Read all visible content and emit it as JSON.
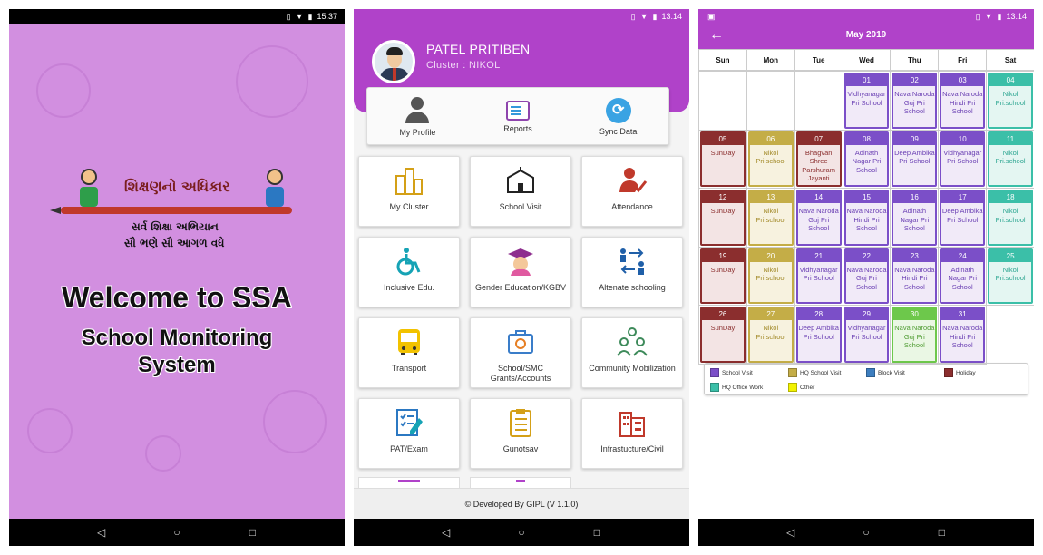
{
  "screen1": {
    "status_time": "15:37",
    "logo_title": "શિક્ષણનો અધિકાર",
    "logo_line1": "સર્વ શિક્ષા અભિયાન",
    "logo_line2": "સૌ ભણે સૌ આગળ વધે",
    "welcome": "Welcome to SSA",
    "subtitle_line1": "School Monitoring",
    "subtitle_line2": "System",
    "background_color": "#d28fe0"
  },
  "screen2": {
    "status_time": "13:14",
    "user_name": "PATEL PRITIBEN",
    "cluster": "Cluster : NIKOL",
    "header_color": "#b042c9",
    "quick_actions": [
      {
        "label": "My Profile",
        "icon": "person-icon"
      },
      {
        "label": "Reports",
        "icon": "reports-icon"
      },
      {
        "label": "Sync Data",
        "icon": "sync-icon"
      }
    ],
    "tiles": [
      {
        "label": "My Cluster",
        "icon": "buildings-icon"
      },
      {
        "label": "School Visit",
        "icon": "school-icon"
      },
      {
        "label": "Attendance",
        "icon": "attendance-icon"
      },
      {
        "label": "Inclusive Edu.",
        "icon": "wheelchair-icon"
      },
      {
        "label": "Gender Education/KGBV",
        "icon": "graduate-icon"
      },
      {
        "label": "Altenate schooling",
        "icon": "exchange-icon"
      },
      {
        "label": "Transport",
        "icon": "bus-icon"
      },
      {
        "label": "School/SMC Grants/Accounts",
        "icon": "wallet-icon"
      },
      {
        "label": "Community Mobilization",
        "icon": "community-icon"
      },
      {
        "label": "PAT/Exam",
        "icon": "exam-icon"
      },
      {
        "label": "Gunotsav",
        "icon": "checklist-icon"
      },
      {
        "label": "Infrastucture/Civil",
        "icon": "building-icon"
      }
    ],
    "footer": "© Developed By GIPL (V 1.1.0)"
  },
  "screen3": {
    "status_time": "13:14",
    "month": "May 2019",
    "days": [
      "Sun",
      "Mon",
      "Tue",
      "Wed",
      "Thu",
      "Fri",
      "Sat"
    ],
    "colors": {
      "school": "#7b4fc8",
      "hq": "#c4ad47",
      "holiday": "#8b2e2e",
      "office": "#3bbfa8",
      "green": "#6dc84b",
      "block": "#3d7ebf",
      "other": "#f2f200"
    },
    "events": [
      {
        "date": "01",
        "text": "Vidhyanagar Pri School",
        "type": "school"
      },
      {
        "date": "02",
        "text": "Nava Naroda Guj Pri School",
        "type": "school"
      },
      {
        "date": "03",
        "text": "Nava Naroda Hindi Pri School",
        "type": "school"
      },
      {
        "date": "04",
        "text": "Nikol Pri.school",
        "type": "office"
      },
      {
        "date": "05",
        "text": "SunDay",
        "type": "holiday"
      },
      {
        "date": "06",
        "text": "Nikol Pri.school",
        "type": "hq"
      },
      {
        "date": "07",
        "text": "Bhagvan Shree Parshuram Jayanti",
        "type": "holiday"
      },
      {
        "date": "08",
        "text": "Adinath Nagar Pri School",
        "type": "school"
      },
      {
        "date": "09",
        "text": "Deep Ambika Pri School",
        "type": "school"
      },
      {
        "date": "10",
        "text": "Vidhyanagar Pri School",
        "type": "school"
      },
      {
        "date": "11",
        "text": "Nikol Pri.school",
        "type": "office"
      },
      {
        "date": "12",
        "text": "SunDay",
        "type": "holiday"
      },
      {
        "date": "13",
        "text": "Nikol Pri.school",
        "type": "hq"
      },
      {
        "date": "14",
        "text": "Nava Naroda Guj Pri School",
        "type": "school"
      },
      {
        "date": "15",
        "text": "Nava Naroda Hindi Pri School",
        "type": "school"
      },
      {
        "date": "16",
        "text": "Adinath Nagar Pri School",
        "type": "school"
      },
      {
        "date": "17",
        "text": "Deep Ambika Pri School",
        "type": "school"
      },
      {
        "date": "18",
        "text": "Nikol Pri.school",
        "type": "office"
      },
      {
        "date": "19",
        "text": "SunDay",
        "type": "holiday"
      },
      {
        "date": "20",
        "text": "Nikol Pri.school",
        "type": "hq"
      },
      {
        "date": "21",
        "text": "Vidhyanagar Pri School",
        "type": "school"
      },
      {
        "date": "22",
        "text": "Nava Naroda Guj Pri School",
        "type": "school"
      },
      {
        "date": "23",
        "text": "Nava Naroda Hindi Pri School",
        "type": "school"
      },
      {
        "date": "24",
        "text": "Adinath Nagar Pri School",
        "type": "school"
      },
      {
        "date": "25",
        "text": "Nikol Pri.school",
        "type": "office"
      },
      {
        "date": "26",
        "text": "SunDay",
        "type": "holiday"
      },
      {
        "date": "27",
        "text": "Nikol Pri.school",
        "type": "hq"
      },
      {
        "date": "28",
        "text": "Deep Ambika Pri School",
        "type": "school"
      },
      {
        "date": "29",
        "text": "Vidhyanagar Pri School",
        "type": "school"
      },
      {
        "date": "30",
        "text": "Nava Naroda Guj Pri School",
        "type": "green"
      },
      {
        "date": "31",
        "text": "Nava Naroda Hindi Pri School",
        "type": "school"
      }
    ],
    "legend": [
      {
        "label": "School Visit",
        "color": "#7b4fc8"
      },
      {
        "label": "HQ School Visit",
        "color": "#c4ad47"
      },
      {
        "label": "Block Visit",
        "color": "#3d7ebf"
      },
      {
        "label": "Holiday",
        "color": "#8b2e2e"
      },
      {
        "label": "HQ Office Work",
        "color": "#3bbfa8"
      },
      {
        "label": "Other",
        "color": "#f2f200"
      }
    ]
  }
}
